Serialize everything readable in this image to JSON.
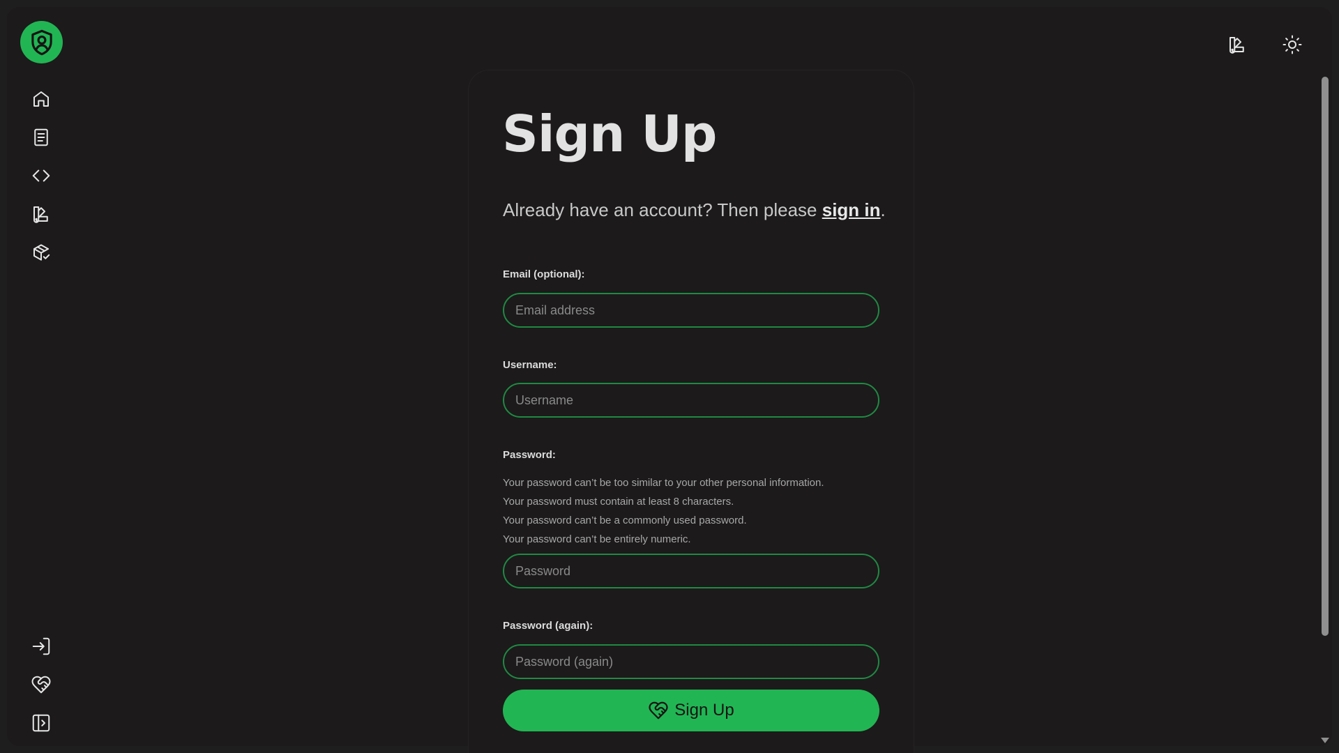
{
  "sidebar": {
    "logo_icon": "shield-user-icon",
    "top_items": [
      {
        "name": "home",
        "icon": "home-icon"
      },
      {
        "name": "docs",
        "icon": "document-icon"
      },
      {
        "name": "code",
        "icon": "code-icon"
      },
      {
        "name": "themes",
        "icon": "swatch-icon"
      },
      {
        "name": "packages",
        "icon": "package-check-icon"
      }
    ],
    "bottom_items": [
      {
        "name": "sign-in",
        "icon": "login-icon"
      },
      {
        "name": "sign-up",
        "icon": "heart-handshake-icon"
      },
      {
        "name": "collapse-sidebar",
        "icon": "sidebar-expand-icon"
      }
    ]
  },
  "topbar": {
    "theme_picker_icon": "swatch-icon",
    "light_mode_icon": "sun-icon"
  },
  "form": {
    "title": "Sign Up",
    "subtitle_prefix": "Already have an account? Then please ",
    "subtitle_link": "sign in",
    "subtitle_suffix": ".",
    "email_label": "Email (optional):",
    "email_placeholder": "Email address",
    "email_value": "",
    "username_label": "Username:",
    "username_placeholder": "Username",
    "username_value": "",
    "password_label": "Password:",
    "password_hints": [
      "Your password can’t be too similar to your other personal information.",
      "Your password must contain at least 8 characters.",
      "Your password can’t be a commonly used password.",
      "Your password can’t be entirely numeric."
    ],
    "password_placeholder": "Password",
    "password_again_label": "Password (again):",
    "password_again_placeholder": "Password (again)",
    "submit_label": "Sign Up",
    "submit_icon": "heart-handshake-icon"
  },
  "colors": {
    "accent": "#22b554",
    "field_border": "#1f8a44",
    "background": "#1c1a1a"
  }
}
